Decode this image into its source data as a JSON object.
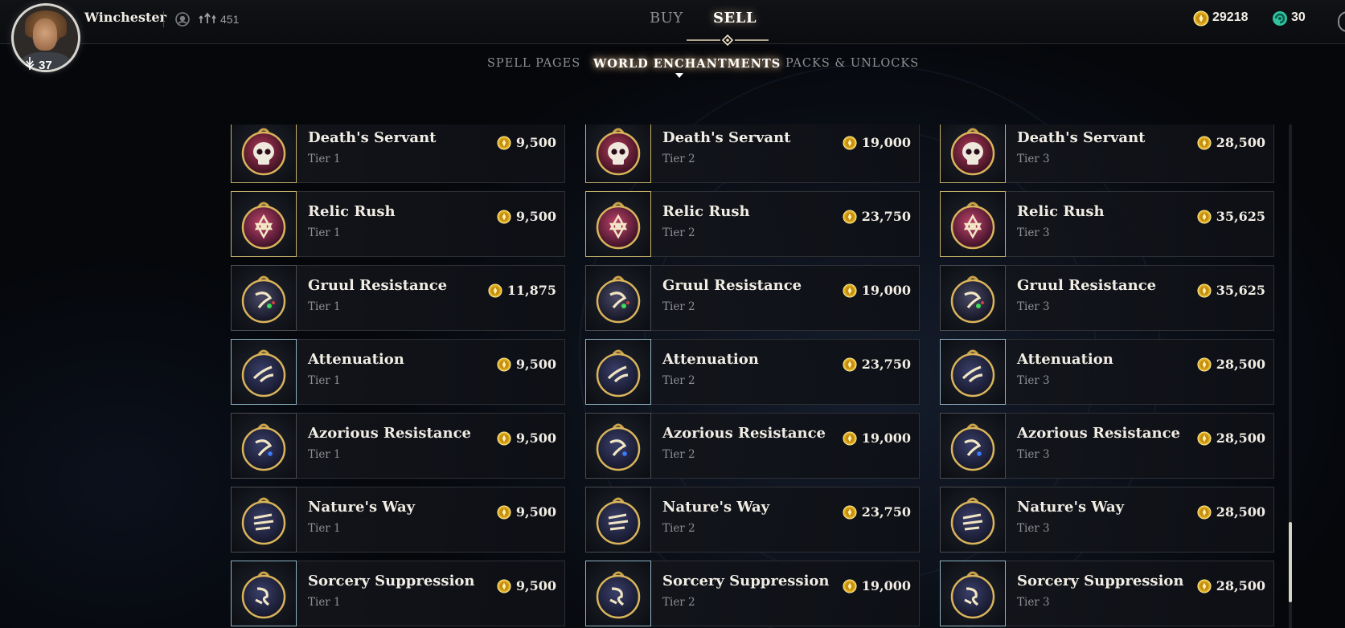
{
  "player": {
    "name": "Winchester",
    "level": "37",
    "mastery": "451"
  },
  "header": {
    "tabs": [
      "BUY",
      "SELL"
    ],
    "active_tab": "SELL",
    "gold": "29218",
    "gems": "30"
  },
  "subtabs": {
    "items": [
      "SPELL PAGES",
      "WORLD ENCHANTMENTS",
      "PACKS & UNLOCKS"
    ],
    "active": "WORLD ENCHANTMENTS"
  },
  "colors": {
    "gold_coin": "#e6b422",
    "gem": "#2fc3a0",
    "thumb_border_gold": "#c7b36a",
    "thumb_border_blue": "#8fb3c4"
  },
  "scroll_position": 0.94,
  "scroll_visible_fraction": 0.16,
  "rows": [
    {
      "name": "Death's Servant",
      "icon": "skull-icon",
      "border": [
        "gold",
        "gold",
        "gold"
      ],
      "cards": [
        {
          "tier": "Tier 1",
          "price": "9,500"
        },
        {
          "tier": "Tier 2",
          "price": "19,000"
        },
        {
          "tier": "Tier 3",
          "price": "28,500"
        }
      ]
    },
    {
      "name": "Relic Rush",
      "icon": "hexagram-icon",
      "border": [
        "gold",
        "gold",
        "gold"
      ],
      "cards": [
        {
          "tier": "Tier 1",
          "price": "9,500"
        },
        {
          "tier": "Tier 2",
          "price": "23,750"
        },
        {
          "tier": "Tier 3",
          "price": "35,625"
        }
      ]
    },
    {
      "name": "Gruul Resistance",
      "icon": "gruul-orb-icon",
      "border": [
        "plain",
        "plain",
        "plain"
      ],
      "cards": [
        {
          "tier": "Tier 1",
          "price": "11,875"
        },
        {
          "tier": "Tier 2",
          "price": "19,000"
        },
        {
          "tier": "Tier 3",
          "price": "35,625"
        }
      ]
    },
    {
      "name": "Attenuation",
      "icon": "swirl-orb-icon",
      "border": [
        "blue",
        "blue",
        "blue"
      ],
      "cards": [
        {
          "tier": "Tier 1",
          "price": "9,500"
        },
        {
          "tier": "Tier 2",
          "price": "23,750"
        },
        {
          "tier": "Tier 3",
          "price": "28,500"
        }
      ]
    },
    {
      "name": "Azorious Resistance",
      "icon": "azorius-orb-icon",
      "border": [
        "plain",
        "plain",
        "plain"
      ],
      "cards": [
        {
          "tier": "Tier 1",
          "price": "9,500"
        },
        {
          "tier": "Tier 2",
          "price": "19,000"
        },
        {
          "tier": "Tier 3",
          "price": "28,500"
        }
      ]
    },
    {
      "name": "Nature's Way",
      "icon": "claw-orb-icon",
      "border": [
        "plain",
        "plain",
        "plain"
      ],
      "cards": [
        {
          "tier": "Tier 1",
          "price": "9,500"
        },
        {
          "tier": "Tier 2",
          "price": "23,750"
        },
        {
          "tier": "Tier 3",
          "price": "28,500"
        }
      ]
    },
    {
      "name": "Sorcery Suppression",
      "icon": "rune-orb-icon",
      "border": [
        "blue",
        "blue",
        "blue"
      ],
      "cards": [
        {
          "tier": "Tier 1",
          "price": "9,500"
        },
        {
          "tier": "Tier 2",
          "price": "19,000"
        },
        {
          "tier": "Tier 3",
          "price": "28,500"
        }
      ]
    }
  ]
}
